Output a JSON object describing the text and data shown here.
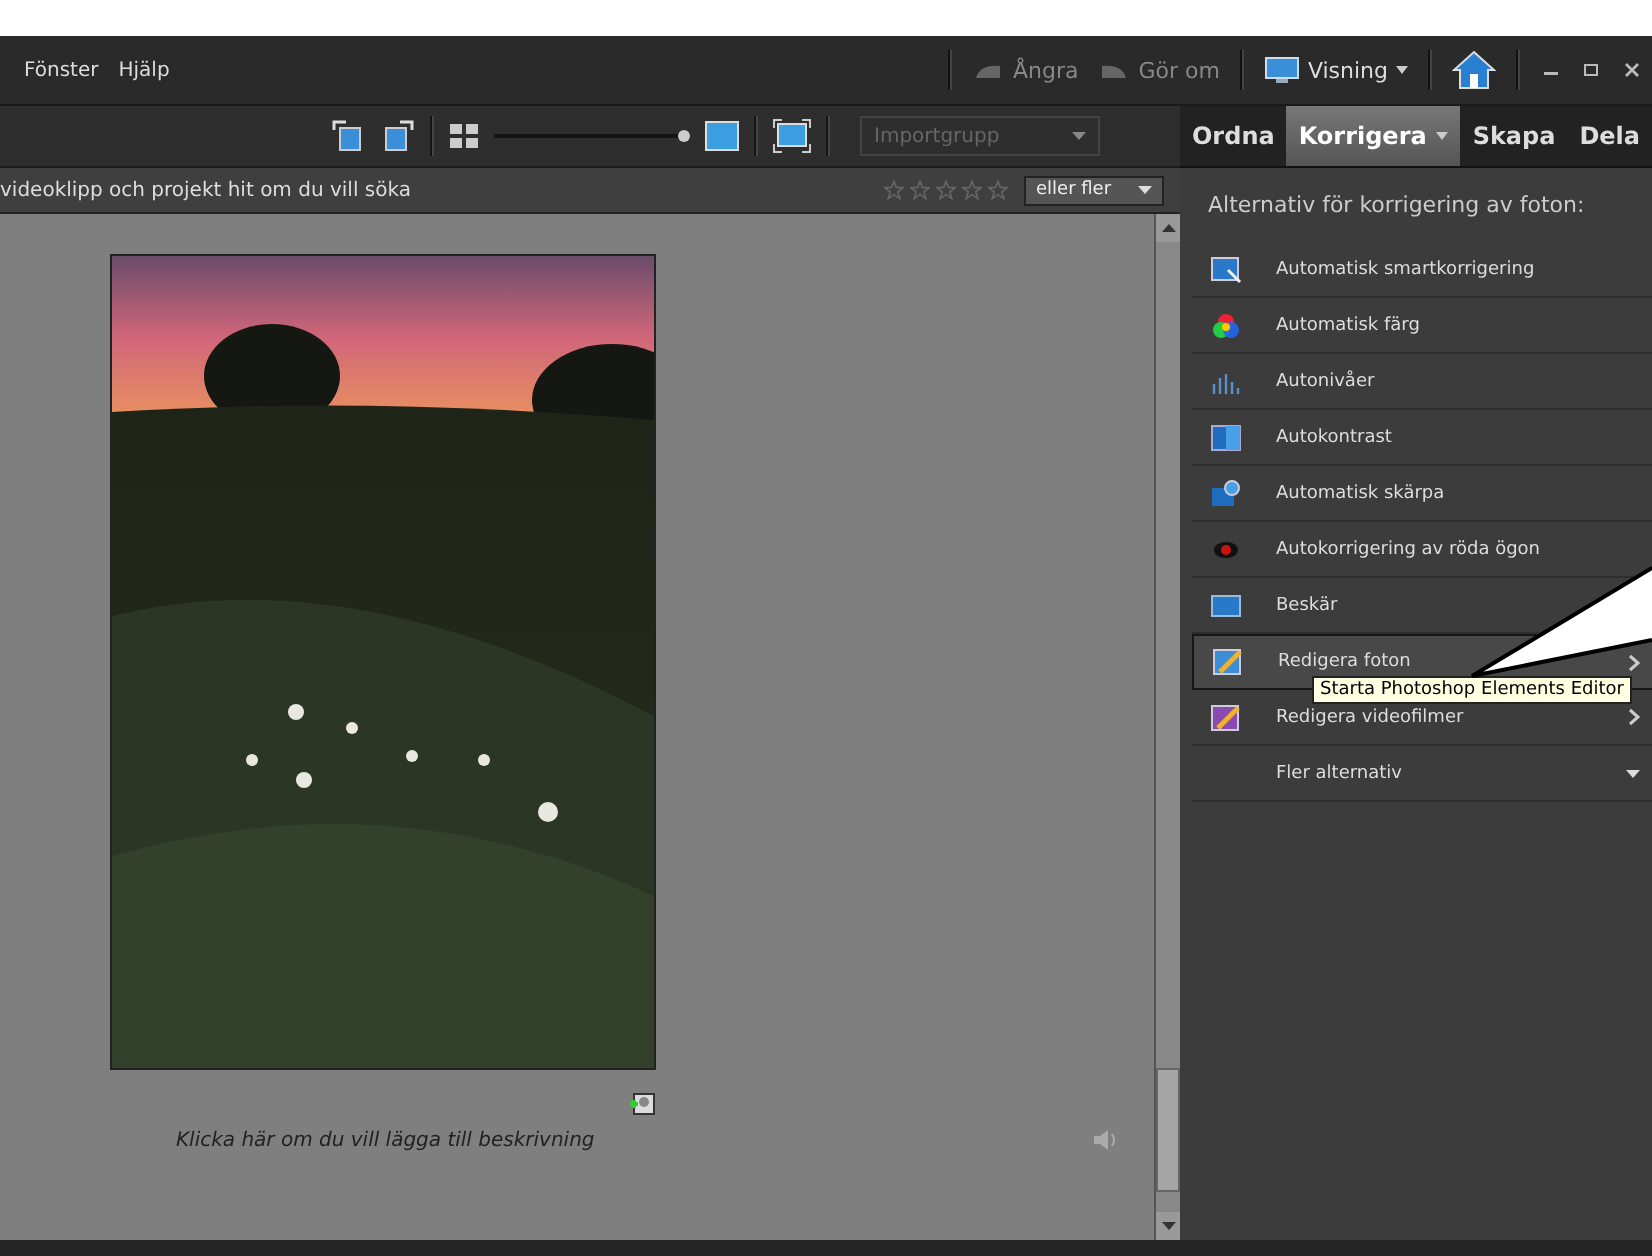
{
  "menu": [
    {
      "label": "Fönster"
    },
    {
      "label": "Hjälp"
    }
  ],
  "history": [
    {
      "label": "Ångra",
      "disabled": true
    },
    {
      "label": "Gör om",
      "disabled": true
    }
  ],
  "view_menu": {
    "label": "Visning"
  },
  "toolbar": {
    "zoom_slider": {
      "level": 0.97
    },
    "group_dropdown": {
      "placeholder": "Importgrupp"
    }
  },
  "tabs": [
    {
      "label": "Ordna",
      "selected": false,
      "caret": false
    },
    {
      "label": "Korrigera",
      "selected": true,
      "caret": true
    },
    {
      "label": "Skapa",
      "selected": false,
      "caret": false
    },
    {
      "label": "Dela",
      "selected": false,
      "caret": false
    }
  ],
  "search_bar": {
    "text": "videoklipp och projekt hit om du vill söka",
    "stars": 0,
    "rating_dropdown": "eller fler"
  },
  "media": {
    "caption": "Klicka här om du vill lägga till beskrivning"
  },
  "panel": {
    "heading": "Alternativ för korrigering av foton:",
    "items": [
      {
        "label": "Automatisk smartkorrigering",
        "kind": "action",
        "selected": false
      },
      {
        "label": "Automatisk färg",
        "kind": "action",
        "selected": false
      },
      {
        "label": "Autonivåer",
        "kind": "action",
        "selected": false
      },
      {
        "label": "Autokontrast",
        "kind": "action",
        "selected": false
      },
      {
        "label": "Automatisk skärpa",
        "kind": "action",
        "selected": false
      },
      {
        "label": "Autokorrigering av röda ögon",
        "kind": "action",
        "selected": false
      },
      {
        "label": "Beskär",
        "kind": "action",
        "selected": false
      },
      {
        "label": "Redigera foton",
        "kind": "submenu",
        "selected": true
      },
      {
        "label": "Redigera videofilmer",
        "kind": "submenu",
        "selected": false
      },
      {
        "label": "Fler alternativ",
        "kind": "more",
        "selected": false
      }
    ]
  },
  "tooltip": {
    "text": "Starta Photoshop Elements Editor"
  }
}
